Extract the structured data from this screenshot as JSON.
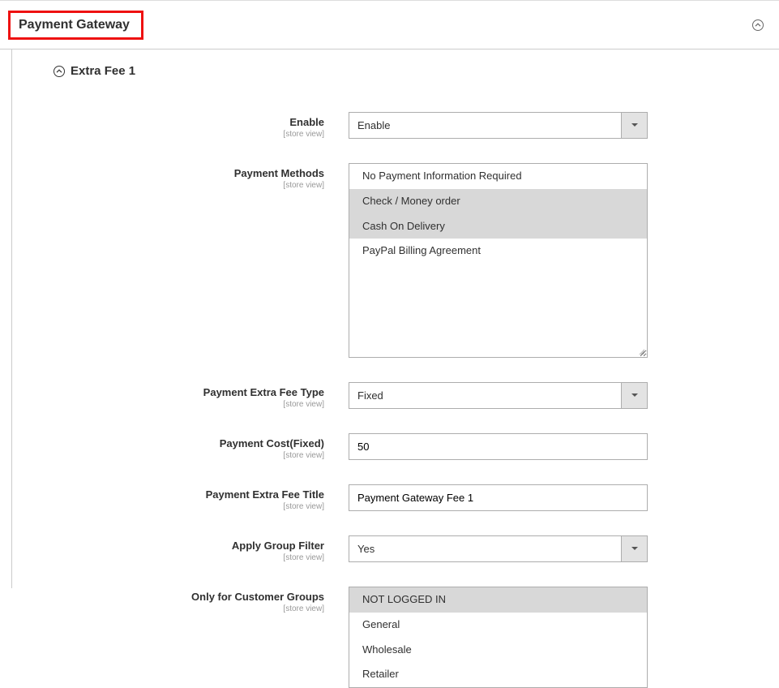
{
  "section": {
    "title": "Payment Gateway"
  },
  "subsection": {
    "title": "Extra Fee 1"
  },
  "fields": {
    "enable": {
      "label": "Enable",
      "scope": "[store view]",
      "value": "Enable"
    },
    "payment_methods": {
      "label": "Payment Methods",
      "scope": "[store view]",
      "options": [
        {
          "label": "No Payment Information Required",
          "selected": false
        },
        {
          "label": "Check / Money order",
          "selected": true
        },
        {
          "label": "Cash On Delivery",
          "selected": true
        },
        {
          "label": "PayPal Billing Agreement",
          "selected": false
        }
      ]
    },
    "fee_type": {
      "label": "Payment Extra Fee Type",
      "scope": "[store view]",
      "value": "Fixed"
    },
    "cost_fixed": {
      "label": "Payment Cost(Fixed)",
      "scope": "[store view]",
      "value": "50"
    },
    "fee_title": {
      "label": "Payment Extra Fee Title",
      "scope": "[store view]",
      "value": "Payment Gateway Fee 1"
    },
    "apply_group": {
      "label": "Apply Group Filter",
      "scope": "[store view]",
      "value": "Yes"
    },
    "customer_groups": {
      "label": "Only for Customer Groups",
      "scope": "[store view]",
      "options": [
        {
          "label": "NOT LOGGED IN",
          "selected": true
        },
        {
          "label": "General",
          "selected": false
        },
        {
          "label": "Wholesale",
          "selected": false
        },
        {
          "label": "Retailer",
          "selected": false
        }
      ]
    }
  }
}
